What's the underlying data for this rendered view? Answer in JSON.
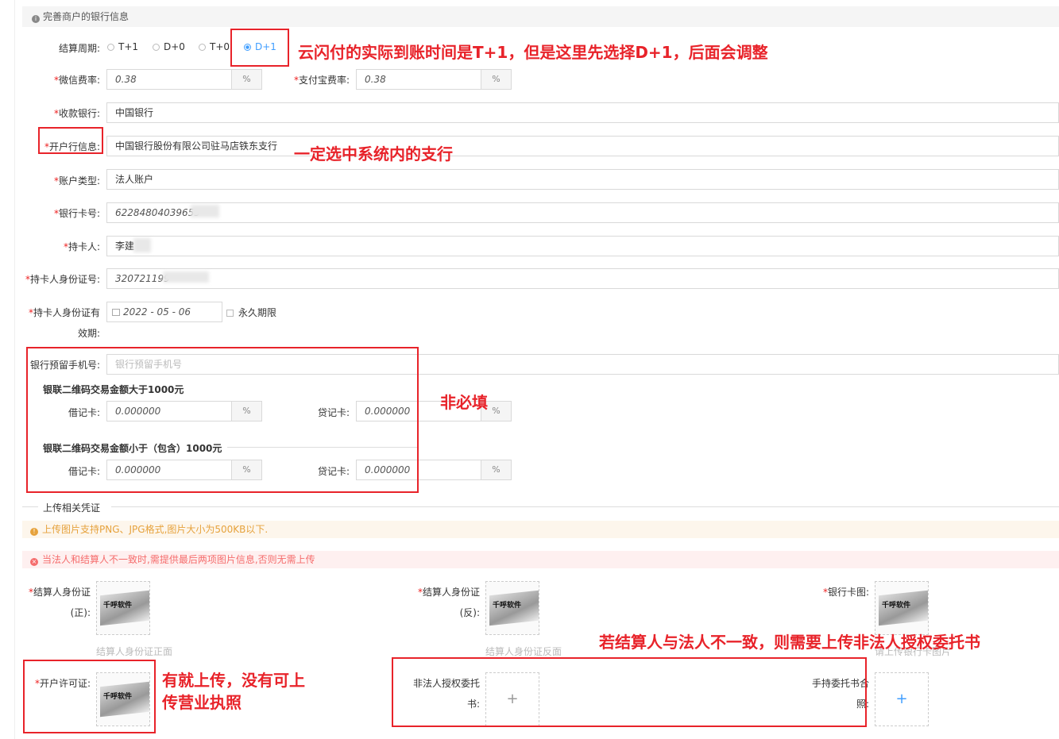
{
  "section": {
    "title": "完善商户的银行信息"
  },
  "settlement": {
    "label": "结算周期",
    "options": [
      "T+1",
      "D+0",
      "T+0",
      "D+1"
    ],
    "selected": "D+1"
  },
  "fees": {
    "wechat_label": "微信费率",
    "wechat_value": "0.38",
    "alipay_label": "支付宝费率",
    "alipay_value": "0.38",
    "unit": "%"
  },
  "bank": {
    "receive_label": "收款银行",
    "receive_value": "中国银行",
    "branch_label": "开户行信息",
    "branch_value": "中国银行股份有限公司驻马店铁东支行",
    "acct_type_label": "账户类型",
    "acct_type_value": "法人账户",
    "card_label": "银行卡号",
    "card_value": "62284804039655",
    "holder_label": "持卡人",
    "holder_value": "李建",
    "id_label": "持卡人身份证号",
    "id_value": "320721199",
    "id_expiry_label_1": "持卡人身份证有",
    "id_expiry_label_2": "效期",
    "id_expiry_value": "2022 - 05 - 06",
    "permanent_label": "永久期限",
    "phone_label": "银行预留手机号",
    "phone_placeholder": "银行预留手机号"
  },
  "unionpay": {
    "over_title": "银联二维码交易金额大于1000元",
    "under_title": "银联二维码交易金额小于（包含）1000元",
    "debit_label": "借记卡",
    "credit_label": "贷记卡",
    "over_debit": "0.000000",
    "over_credit": "0.000000",
    "under_debit": "0.000000",
    "under_credit": "0.000000",
    "unit": "%"
  },
  "upload": {
    "section_title": "上传相关凭证",
    "warn": "上传图片支持PNG、JPG格式,图片大小为500KB以下.",
    "err": "当法人和结算人不一致时,需提供最后两项图片信息,否则无需上传",
    "id_front_label_1": "结算人身份证",
    "id_front_label_2": "(正)",
    "id_front_caption": "结算人身份证正面",
    "id_back_label_1": "结算人身份证",
    "id_back_label_2": "(反)",
    "id_back_caption": "结算人身份证反面",
    "bank_card_label": "银行卡图",
    "bank_card_caption": "请上传银行卡图片",
    "license_label": "开户许可证",
    "auth_label_1": "非法人授权委托",
    "auth_label_2": "书",
    "hand_label_1": "手持委托书合",
    "hand_label_2": "照",
    "logo_text": "千呼软件",
    "plus": "+"
  },
  "annotations": {
    "settlement_note": "云闪付的实际到账时间是T+1，但是这里先选择D+1，后面会调整",
    "branch_note": "一定选中系统内的支行",
    "optional_note": "非必填",
    "auth_note": "若结算人与法人不一致，则需要上传非法人授权委托书",
    "license_note_1": "有就上传，没有可上",
    "license_note_2": "传营业执照"
  },
  "colors": {
    "accent": "#409eff",
    "annotation": "#e8232a",
    "warn": "#e6a23c",
    "error": "#f56c6c"
  }
}
